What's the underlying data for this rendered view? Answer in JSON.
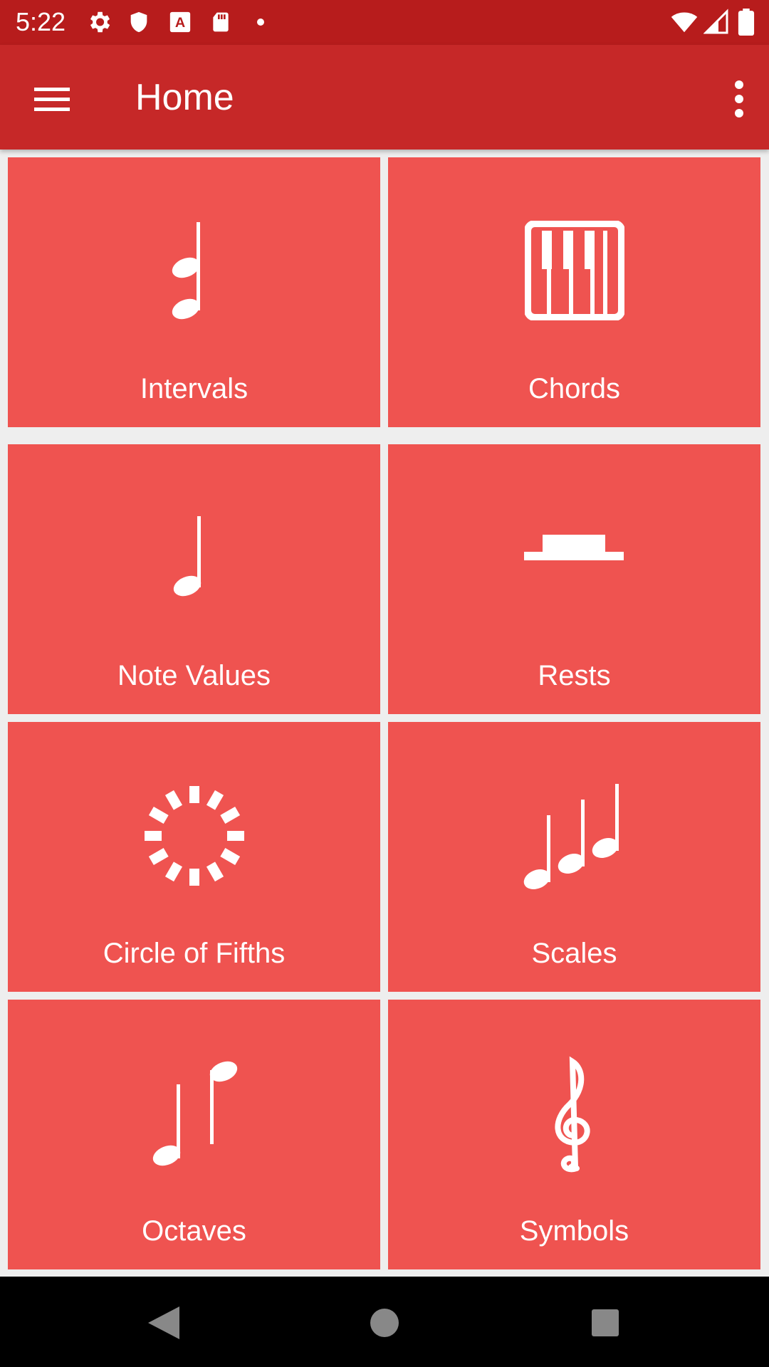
{
  "status_bar": {
    "time": "5:22",
    "left_icons": [
      "gear-icon",
      "shield-icon",
      "font-icon",
      "sd-card-icon",
      "dot-icon"
    ],
    "right_icons": [
      "wifi-icon",
      "signal-icon",
      "battery-icon"
    ]
  },
  "app_bar": {
    "title": "Home",
    "menu_icon": "hamburger-menu-icon",
    "overflow_icon": "more-vertical-icon"
  },
  "tiles": [
    {
      "label": "Intervals",
      "icon": "interval-notes-icon"
    },
    {
      "label": "Chords",
      "icon": "piano-keys-icon"
    },
    {
      "label": "Note Values",
      "icon": "half-note-icon"
    },
    {
      "label": "Rests",
      "icon": "rest-icon"
    },
    {
      "label": "Circle of Fifths",
      "icon": "circle-of-fifths-icon"
    },
    {
      "label": "Scales",
      "icon": "scale-notes-icon"
    },
    {
      "label": "Octaves",
      "icon": "octave-notes-icon"
    },
    {
      "label": "Symbols",
      "icon": "treble-clef-icon"
    }
  ],
  "nav_bar": {
    "back_icon": "back-triangle-icon",
    "home_icon": "home-circle-icon",
    "recents_icon": "recents-square-icon"
  },
  "colors": {
    "status_bar": "#b71c1c",
    "app_bar": "#c62828",
    "tile": "#ef5350",
    "background": "#eeeeee"
  }
}
